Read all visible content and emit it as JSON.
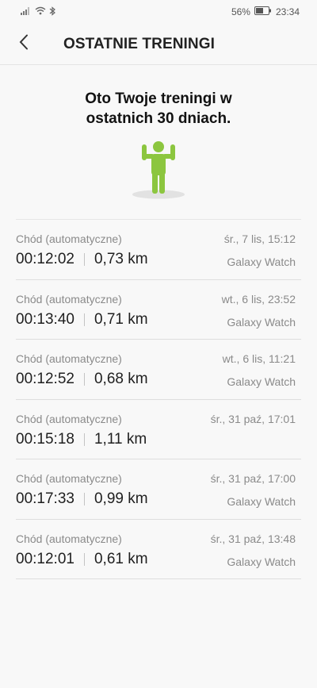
{
  "status_bar": {
    "battery": "56%",
    "time": "23:34"
  },
  "header": {
    "title": "OSTATNIE TRENINGI"
  },
  "intro": {
    "line1": "Oto Twoje treningi w",
    "line2": "ostatnich 30 dniach."
  },
  "colors": {
    "accent": "#8cc63f",
    "shadow": "#e2e2e2"
  },
  "workouts": [
    {
      "type": "Chód (automatyczne)",
      "date": "śr., 7 lis, 15:12",
      "duration": "00:12:02",
      "distance": "0,73 km",
      "device": "Galaxy Watch"
    },
    {
      "type": "Chód (automatyczne)",
      "date": "wt., 6 lis, 23:52",
      "duration": "00:13:40",
      "distance": "0,71 km",
      "device": "Galaxy Watch"
    },
    {
      "type": "Chód (automatyczne)",
      "date": "wt., 6 lis, 11:21",
      "duration": "00:12:52",
      "distance": "0,68 km",
      "device": "Galaxy Watch"
    },
    {
      "type": "Chód (automatyczne)",
      "date": "śr., 31 paź, 17:01",
      "duration": "00:15:18",
      "distance": "1,11 km",
      "device": ""
    },
    {
      "type": "Chód (automatyczne)",
      "date": "śr., 31 paź, 17:00",
      "duration": "00:17:33",
      "distance": "0,99 km",
      "device": "Galaxy Watch"
    },
    {
      "type": "Chód (automatyczne)",
      "date": "śr., 31 paź, 13:48",
      "duration": "00:12:01",
      "distance": "0,61 km",
      "device": "Galaxy Watch"
    }
  ]
}
